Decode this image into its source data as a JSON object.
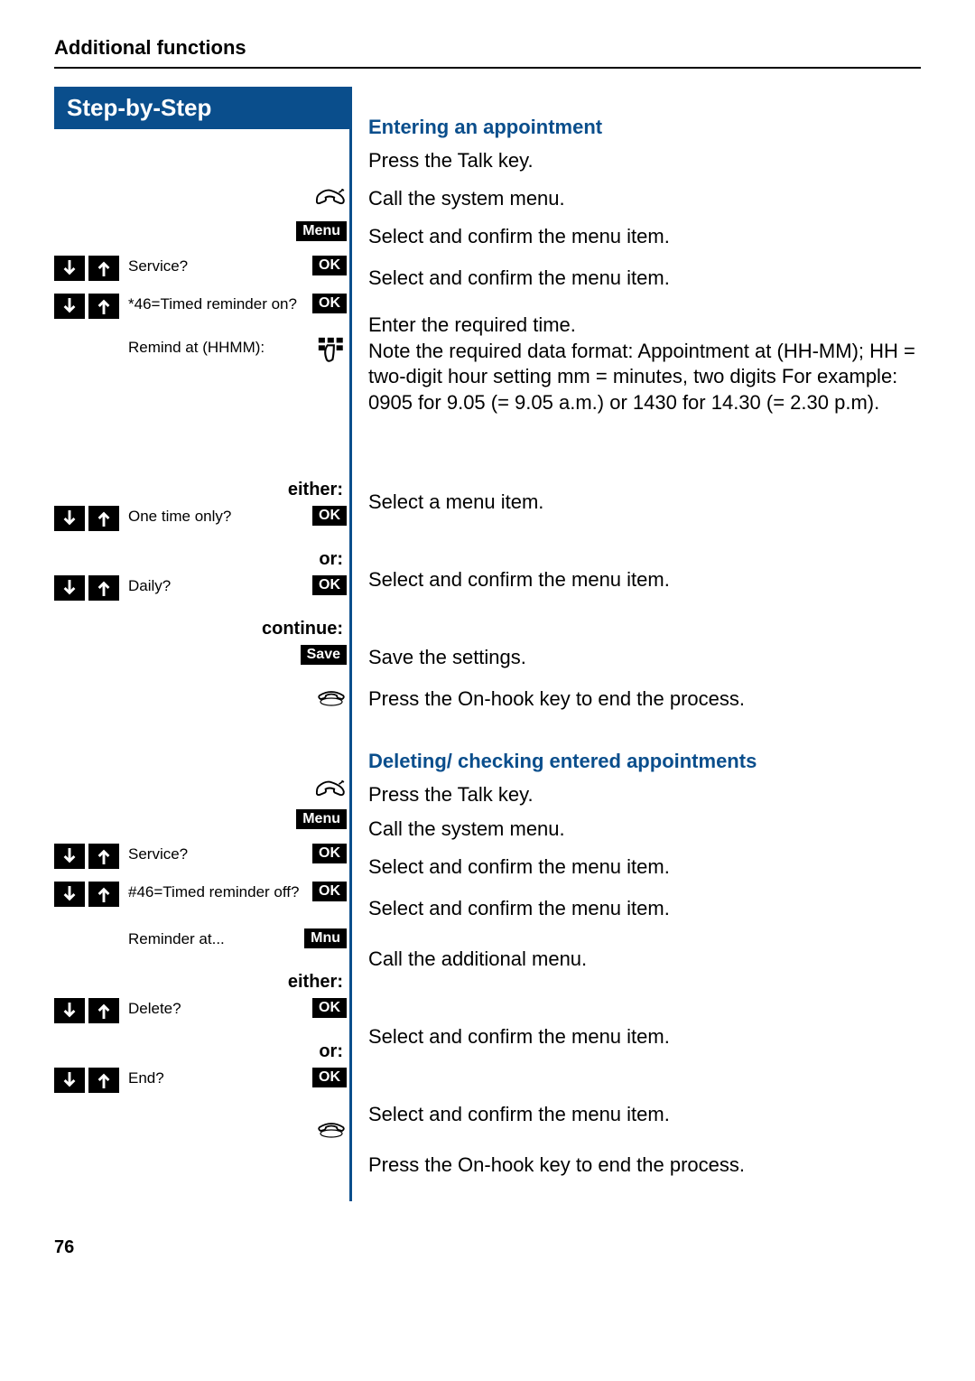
{
  "header": "Additional functions",
  "step_header": "Step-by-Step",
  "page_number": "76",
  "buttons": {
    "menu": "Menu",
    "ok": "OK",
    "save": "Save",
    "mnu": "Mnu"
  },
  "flow": {
    "either": "either:",
    "or": "or:",
    "continue": "continue:"
  },
  "sections": {
    "entering": "Entering an appointment",
    "deleting": "Deleting/ checking entered appointments"
  },
  "rows": {
    "talk1": "Press the Talk key.",
    "menu1": "Call the system menu.",
    "service1_menu": "Service?",
    "service1_desc": "Select and confirm the menu item.",
    "timed_on_menu": "*46=Timed reminder on?",
    "timed_on_desc": "Select and confirm the menu item.",
    "remind_menu": "Remind at (HHMM):",
    "remind_desc": "Enter the required time.\nNote the required data format: Appointment at (HH-MM); HH = two-digit hour setting mm = minutes, two digits For example: 0905 for 9.05 (= 9.05 a.m.) or 1430 for 14.30 (= 2.30 p.m).",
    "onetime_menu": "One time only?",
    "onetime_desc": "Select a menu item.",
    "daily_menu": "Daily?",
    "daily_desc": "Select and confirm the menu item.",
    "save_desc": "Save the settings.",
    "onhook1_desc": "Press the On-hook key to end the process.",
    "talk2": "Press the Talk key.",
    "menu2": "Call the system menu.",
    "service2_menu": "Service?",
    "service2_desc": "Select and confirm the menu item.",
    "timed_off_menu": "#46=Timed reminder off?",
    "timed_off_desc": "Select and confirm the menu item.",
    "reminder_at_menu": "Reminder at...",
    "reminder_at_desc": "Call the additional menu.",
    "delete_menu": "Delete?",
    "delete_desc": "Select and confirm the menu item.",
    "end_menu": "End?",
    "end_desc": "Select and confirm the menu item.",
    "onhook2_desc": "Press the On-hook key to end the process."
  }
}
